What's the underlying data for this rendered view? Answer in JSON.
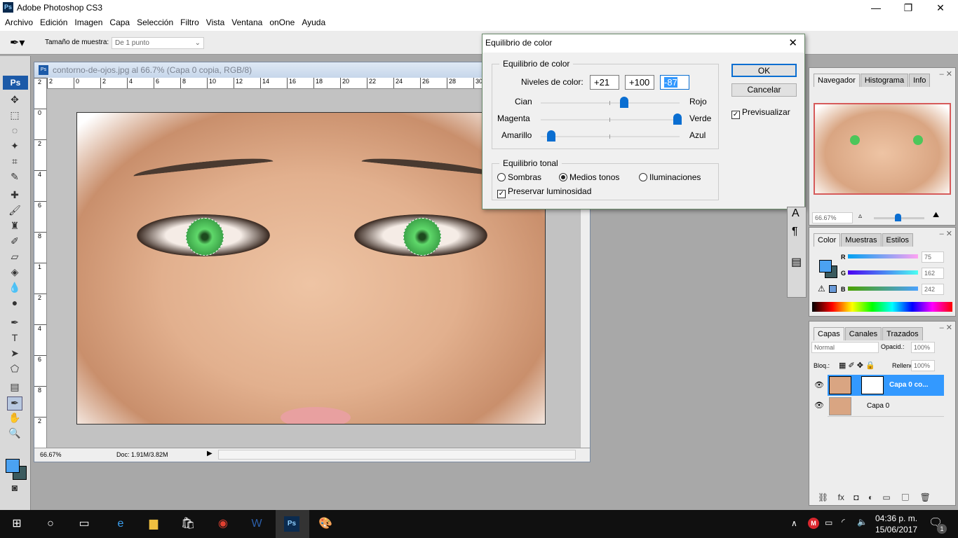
{
  "app": {
    "title": "Adobe Photoshop CS3",
    "logo": "Ps"
  },
  "menu": [
    "Archivo",
    "Edición",
    "Imagen",
    "Capa",
    "Selección",
    "Filtro",
    "Vista",
    "Ventana",
    "onOne",
    "Ayuda"
  ],
  "options": {
    "sample_label": "Tamaño de muestra:",
    "sample_value": "De 1 punto"
  },
  "document": {
    "title": "contorno-de-ojos.jpg al 66.7% (Capa 0 copia, RGB/8)",
    "zoom": "66.67%",
    "doc_size": "Doc: 1.91M/3.82M",
    "ruler_top": [
      "2",
      "0",
      "2",
      "4",
      "6",
      "8",
      "10",
      "12",
      "14",
      "16",
      "18",
      "20",
      "22",
      "24",
      "26",
      "28",
      "30"
    ],
    "ruler_left": [
      "2",
      "0",
      "2",
      "4",
      "6",
      "8",
      "1",
      "2",
      "4",
      "6",
      "8",
      "2"
    ]
  },
  "dialog": {
    "title": "Equilibrio de color",
    "group1": "Equilibrio de color",
    "levels_label": "Niveles de color:",
    "levels": [
      "+21",
      "+100",
      "-87"
    ],
    "sliders": [
      {
        "left": "Cian",
        "right": "Rojo",
        "value": 21
      },
      {
        "left": "Magenta",
        "right": "Verde",
        "value": 100
      },
      {
        "left": "Amarillo",
        "right": "Azul",
        "value": -87
      }
    ],
    "group2": "Equilibrio tonal",
    "tones": [
      "Sombras",
      "Medios tonos",
      "Iluminaciones"
    ],
    "selected_tone": "Medios tonos",
    "preserve": "Preservar luminosidad",
    "ok": "OK",
    "cancel": "Cancelar",
    "preview": "Previsualizar"
  },
  "navigator": {
    "tabs": [
      "Navegador",
      "Histograma",
      "Info"
    ],
    "zoom": "66.67%"
  },
  "color": {
    "tabs": [
      "Color",
      "Muestras",
      "Estilos"
    ],
    "r": "75",
    "g": "162",
    "b": "242",
    "labels": [
      "R",
      "G",
      "B"
    ],
    "foreground": "#4ba2f2",
    "background": "#3a5a5e"
  },
  "layers": {
    "tabs": [
      "Capas",
      "Canales",
      "Trazados"
    ],
    "blend": "Normal",
    "opacity_label": "Opacid.:",
    "opacity": "100%",
    "lock_label": "Bloq.:",
    "fill_label": "Relleno:",
    "fill": "100%",
    "items": [
      {
        "name": "Capa 0 co...",
        "selected": true
      },
      {
        "name": "Capa 0",
        "selected": false
      }
    ]
  },
  "taskbar": {
    "time": "04:36 p. m.",
    "date": "15/06/2017",
    "notifications": "1"
  },
  "accent": "#3399ff"
}
